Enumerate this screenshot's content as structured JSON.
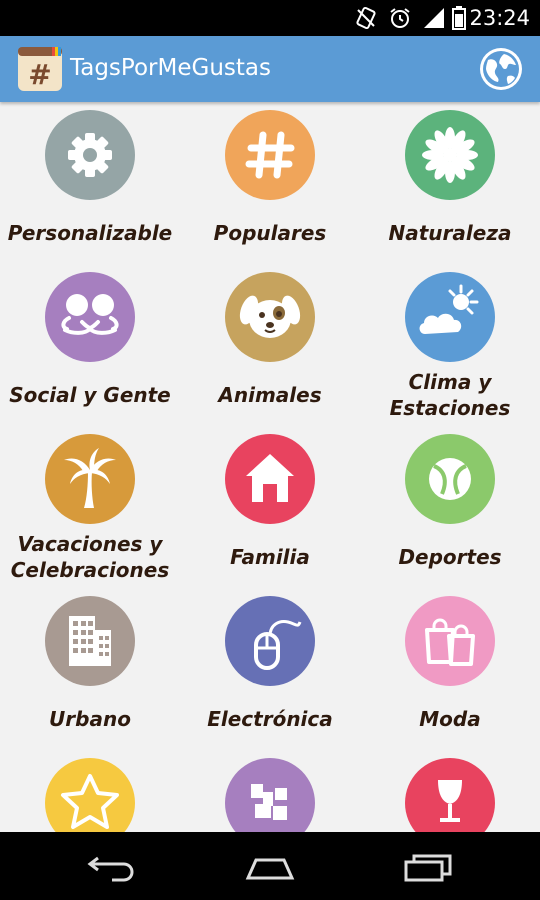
{
  "status_bar": {
    "time": "23:24"
  },
  "app_bar": {
    "title": "TagsPorMeGustas"
  },
  "categories": [
    {
      "label": "Personalizable",
      "icon": "gear-icon",
      "color": "#95a5a6"
    },
    {
      "label": "Populares",
      "icon": "hashtag-icon",
      "color": "#f0a55a"
    },
    {
      "label": "Naturaleza",
      "icon": "flower-icon",
      "color": "#5cb37c"
    },
    {
      "label": "Social y Gente",
      "icon": "people-icon",
      "color": "#a67fbf"
    },
    {
      "label": "Animales",
      "icon": "dog-icon",
      "color": "#c6a35e"
    },
    {
      "label": "Clima y Estaciones",
      "icon": "weather-icon",
      "color": "#5b9bd5"
    },
    {
      "label": "Vacaciones y Celebraciones",
      "icon": "palm-tree-icon",
      "color": "#d79a3b"
    },
    {
      "label": "Familia",
      "icon": "house-icon",
      "color": "#e8435f"
    },
    {
      "label": "Deportes",
      "icon": "ball-icon",
      "color": "#8bc96b"
    },
    {
      "label": "Urbano",
      "icon": "building-icon",
      "color": "#a89a92"
    },
    {
      "label": "Electrónica",
      "icon": "mouse-icon",
      "color": "#6670b5"
    },
    {
      "label": "Moda",
      "icon": "shopping-bags-icon",
      "color": "#f09ac4"
    },
    {
      "label": "",
      "icon": "star-icon",
      "color": "#f6c940"
    },
    {
      "label": "",
      "icon": "blocks-icon",
      "color": "#a67fbf"
    },
    {
      "label": "",
      "icon": "wine-glass-icon",
      "color": "#e8435f"
    }
  ],
  "colors": {
    "app_bar": "#5b9bd5",
    "background": "#f2f2f2",
    "label_text": "#2e1a0e"
  }
}
